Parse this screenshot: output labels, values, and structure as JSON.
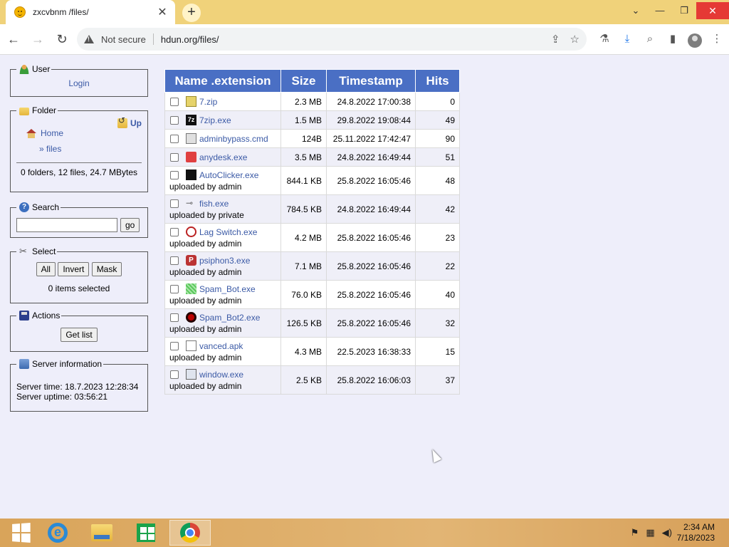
{
  "browser": {
    "tab_title": "zxcvbnm /files/",
    "tab_close": "✕",
    "new_tab": "+",
    "win_min": "—",
    "win_restore": "❐",
    "win_close": "✕",
    "win_menu": "⌄",
    "not_secure": "Not secure",
    "url": "hdun.org/files/"
  },
  "sidebar": {
    "user": {
      "legend": "User",
      "login": "Login"
    },
    "folder": {
      "legend": "Folder",
      "up": "Up",
      "home": "Home",
      "files": "» files",
      "summary": "0 folders, 12 files, 24.7 MBytes"
    },
    "search": {
      "legend": "Search",
      "go": "go",
      "value": ""
    },
    "select": {
      "legend": "Select",
      "all": "All",
      "invert": "Invert",
      "mask": "Mask",
      "status": "0 items selected"
    },
    "actions": {
      "legend": "Actions",
      "get_list": "Get list"
    },
    "server": {
      "legend": "Server information",
      "time": "Server time: 18.7.2023 12:28:34",
      "uptime": "Server uptime: 03:56:21"
    }
  },
  "table": {
    "headers": {
      "name": "Name .extension",
      "size": "Size",
      "timestamp": "Timestamp",
      "hits": "Hits"
    },
    "rows": [
      {
        "name": "7.zip",
        "size": "2.3 MB",
        "timestamp": "24.8.2022 17:00:38",
        "hits": "0",
        "uploader": "",
        "icon": "zip-icon"
      },
      {
        "name": "7zip.exe",
        "size": "1.5 MB",
        "timestamp": "29.8.2022 19:08:44",
        "hits": "49",
        "uploader": "",
        "icon": "7zip-icon"
      },
      {
        "name": "adminbypass.cmd",
        "size": "124B",
        "timestamp": "25.11.2022 17:42:47",
        "hits": "90",
        "uploader": "",
        "icon": "cmd-icon"
      },
      {
        "name": "anydesk.exe",
        "size": "3.5 MB",
        "timestamp": "24.8.2022 16:49:44",
        "hits": "51",
        "uploader": "",
        "icon": "anydesk-icon"
      },
      {
        "name": "AutoClicker.exe",
        "size": "844.1 KB",
        "timestamp": "25.8.2022 16:05:46",
        "hits": "48",
        "uploader": "uploaded by admin",
        "icon": "autoclicker-icon"
      },
      {
        "name": "fish.exe",
        "size": "784.5 KB",
        "timestamp": "24.8.2022 16:49:44",
        "hits": "42",
        "uploader": "uploaded by private",
        "icon": "fish-icon"
      },
      {
        "name": "Lag Switch.exe",
        "size": "4.2 MB",
        "timestamp": "25.8.2022 16:05:46",
        "hits": "23",
        "uploader": "uploaded by admin",
        "icon": "lag-switch-icon"
      },
      {
        "name": "psiphon3.exe",
        "size": "7.1 MB",
        "timestamp": "25.8.2022 16:05:46",
        "hits": "22",
        "uploader": "uploaded by admin",
        "icon": "psiphon-icon"
      },
      {
        "name": "Spam_Bot.exe",
        "size": "76.0 KB",
        "timestamp": "25.8.2022 16:05:46",
        "hits": "40",
        "uploader": "uploaded by admin",
        "icon": "spam-bot-icon"
      },
      {
        "name": "Spam_Bot2.exe",
        "size": "126.5 KB",
        "timestamp": "25.8.2022 16:05:46",
        "hits": "32",
        "uploader": "uploaded by admin",
        "icon": "spam-bot2-icon"
      },
      {
        "name": "vanced.apk",
        "size": "4.3 MB",
        "timestamp": "22.5.2023 16:38:33",
        "hits": "15",
        "uploader": "uploaded by admin",
        "icon": "file-icon"
      },
      {
        "name": "window.exe",
        "size": "2.5 KB",
        "timestamp": "25.8.2022 16:06:03",
        "hits": "37",
        "uploader": "uploaded by admin",
        "icon": "window-icon"
      }
    ]
  },
  "taskbar": {
    "time": "2:34 AM",
    "date": "7/18/2023"
  }
}
